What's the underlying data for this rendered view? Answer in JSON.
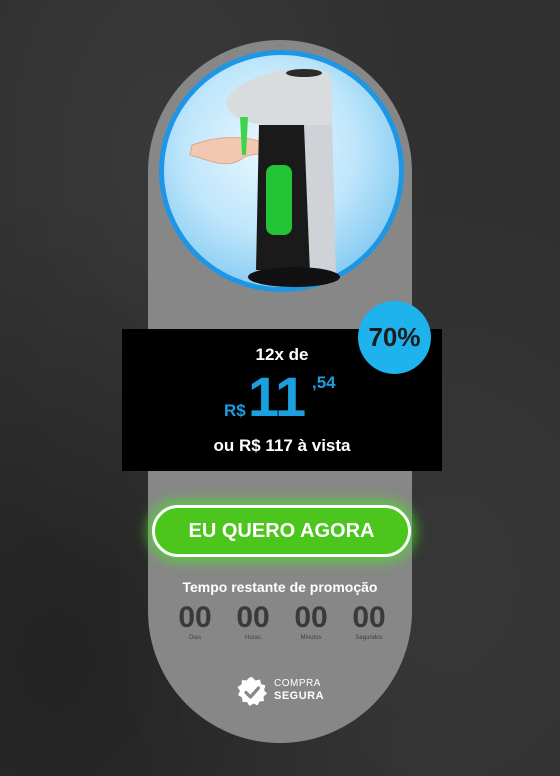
{
  "product": {
    "image_alt": "automatic soap dispenser"
  },
  "offer": {
    "discount": "70%",
    "installments_text": "12x de",
    "currency": "R$",
    "price_integer": "11",
    "price_cents": ",54",
    "cash_text": "ou R$ 117 à vista"
  },
  "cta": {
    "label": "EU QUERO AGORA"
  },
  "countdown": {
    "title": "Tempo restante de promoção",
    "units": [
      {
        "value": "00",
        "label": "Dias"
      },
      {
        "value": "00",
        "label": "Horas"
      },
      {
        "value": "00",
        "label": "Minutos"
      },
      {
        "value": "00",
        "label": "Segundos"
      }
    ]
  },
  "secure_badge": {
    "line1": "COMPRA",
    "line2": "SEGURA",
    "icon": "shield-check-icon"
  },
  "colors": {
    "accent": "#1a9fe0",
    "cta": "#4cc51d",
    "panel": "#878787"
  }
}
